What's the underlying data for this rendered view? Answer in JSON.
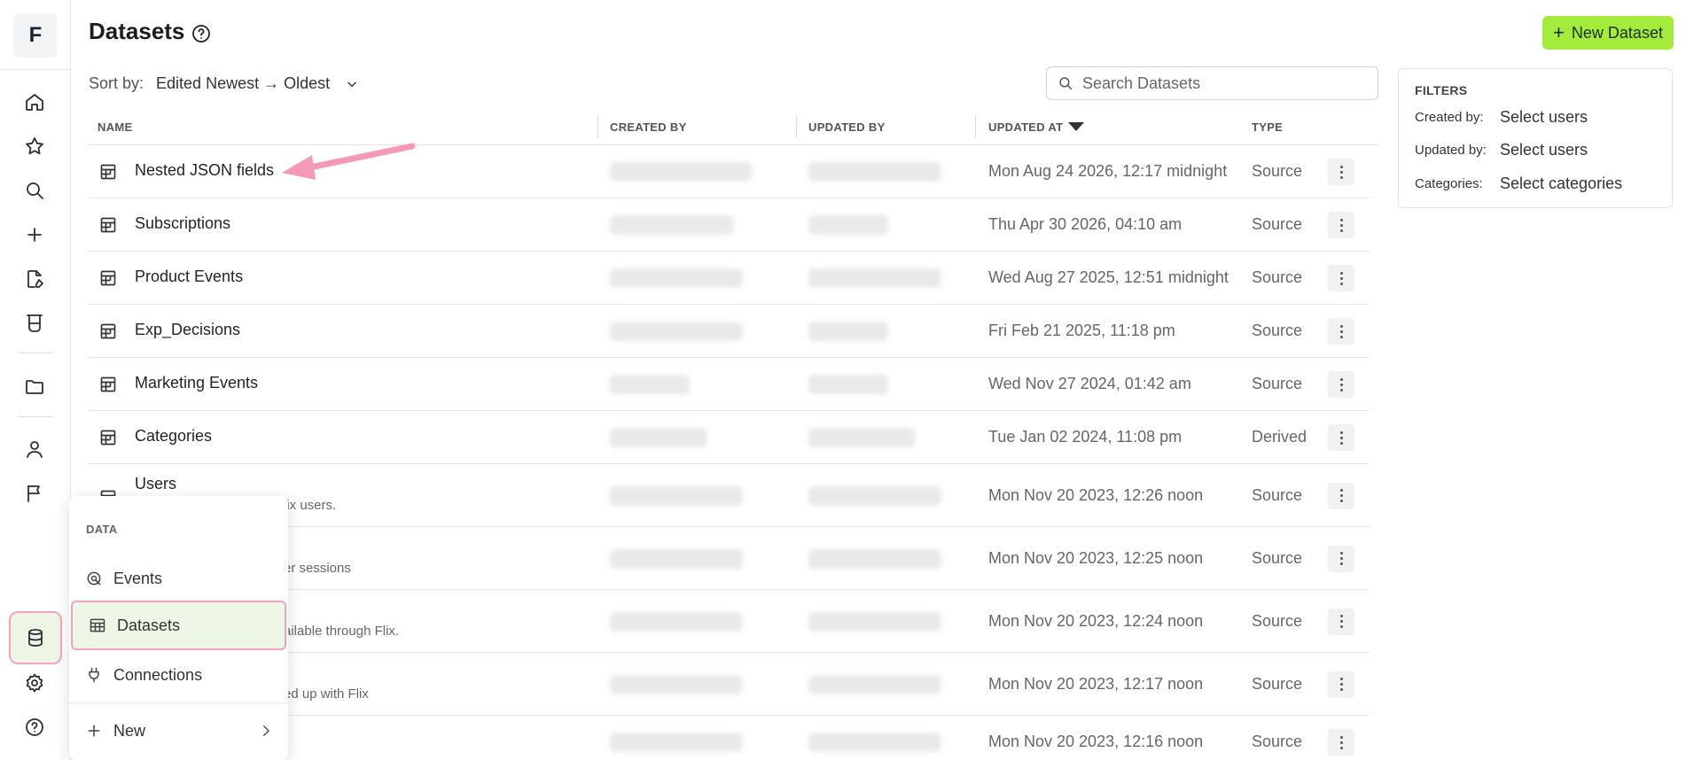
{
  "app": {
    "logo_letter": "F"
  },
  "header": {
    "title": "Datasets",
    "new_button_label": "New Dataset"
  },
  "sort": {
    "label": "Sort by:",
    "value": "Edited Newest → Oldest"
  },
  "search": {
    "placeholder": "Search Datasets"
  },
  "table": {
    "columns": [
      "NAME",
      "CREATED BY",
      "UPDATED BY",
      "UPDATED AT",
      "TYPE"
    ],
    "rows": [
      {
        "name": "Nested JSON fields",
        "desc": "",
        "updated_at": "Mon Aug 24 2026, 12:17 midnight",
        "type": "Source"
      },
      {
        "name": "Subscriptions",
        "desc": "",
        "updated_at": "Thu Apr 30 2026, 04:10 am",
        "type": "Source"
      },
      {
        "name": "Product Events",
        "desc": "",
        "updated_at": "Wed Aug 27 2025, 12:51 midnight",
        "type": "Source"
      },
      {
        "name": "Exp_Decisions",
        "desc": "",
        "updated_at": "Fri Feb 21 2025, 11:18 pm",
        "type": "Source"
      },
      {
        "name": "Marketing Events",
        "desc": "",
        "updated_at": "Wed Nov 27 2024, 01:42 am",
        "type": "Source"
      },
      {
        "name": "Categories",
        "desc": "",
        "updated_at": "Tue Jan 02 2024, 11:08 pm",
        "type": "Derived"
      },
      {
        "name": "Users",
        "desc": "lix users.",
        "updated_at": "Mon Nov 20 2023, 12:26 noon",
        "type": "Source"
      },
      {
        "name": "",
        "desc": "er sessions",
        "updated_at": "Mon Nov 20 2023, 12:25 noon",
        "type": "Source"
      },
      {
        "name": "",
        "desc": "ailable through Flix.",
        "updated_at": "Mon Nov 20 2023, 12:24 noon",
        "type": "Source"
      },
      {
        "name": "",
        "desc": "ed up with Flix",
        "updated_at": "Mon Nov 20 2023, 12:17 noon",
        "type": "Source"
      },
      {
        "name": "",
        "desc": "",
        "updated_at": "Mon Nov 20 2023, 12:16 noon",
        "type": "Source"
      }
    ]
  },
  "filters": {
    "title": "FILTERS",
    "created_by_label": "Created by:",
    "created_by_value": "Select users",
    "updated_by_label": "Updated by:",
    "updated_by_value": "Select users",
    "categories_label": "Categories:",
    "categories_value": "Select categories"
  },
  "data_menu": {
    "title": "DATA",
    "items": [
      {
        "label": "Events",
        "icon": "events-icon"
      },
      {
        "label": "Datasets",
        "icon": "table-grid-icon"
      },
      {
        "label": "Connections",
        "icon": "plug-icon"
      },
      {
        "label": "New",
        "icon": "plus-icon"
      }
    ]
  },
  "colors": {
    "accent_button": "#a3ec3c",
    "highlight_border": "#f0a3bd",
    "active_bg": "#eef6e6"
  }
}
